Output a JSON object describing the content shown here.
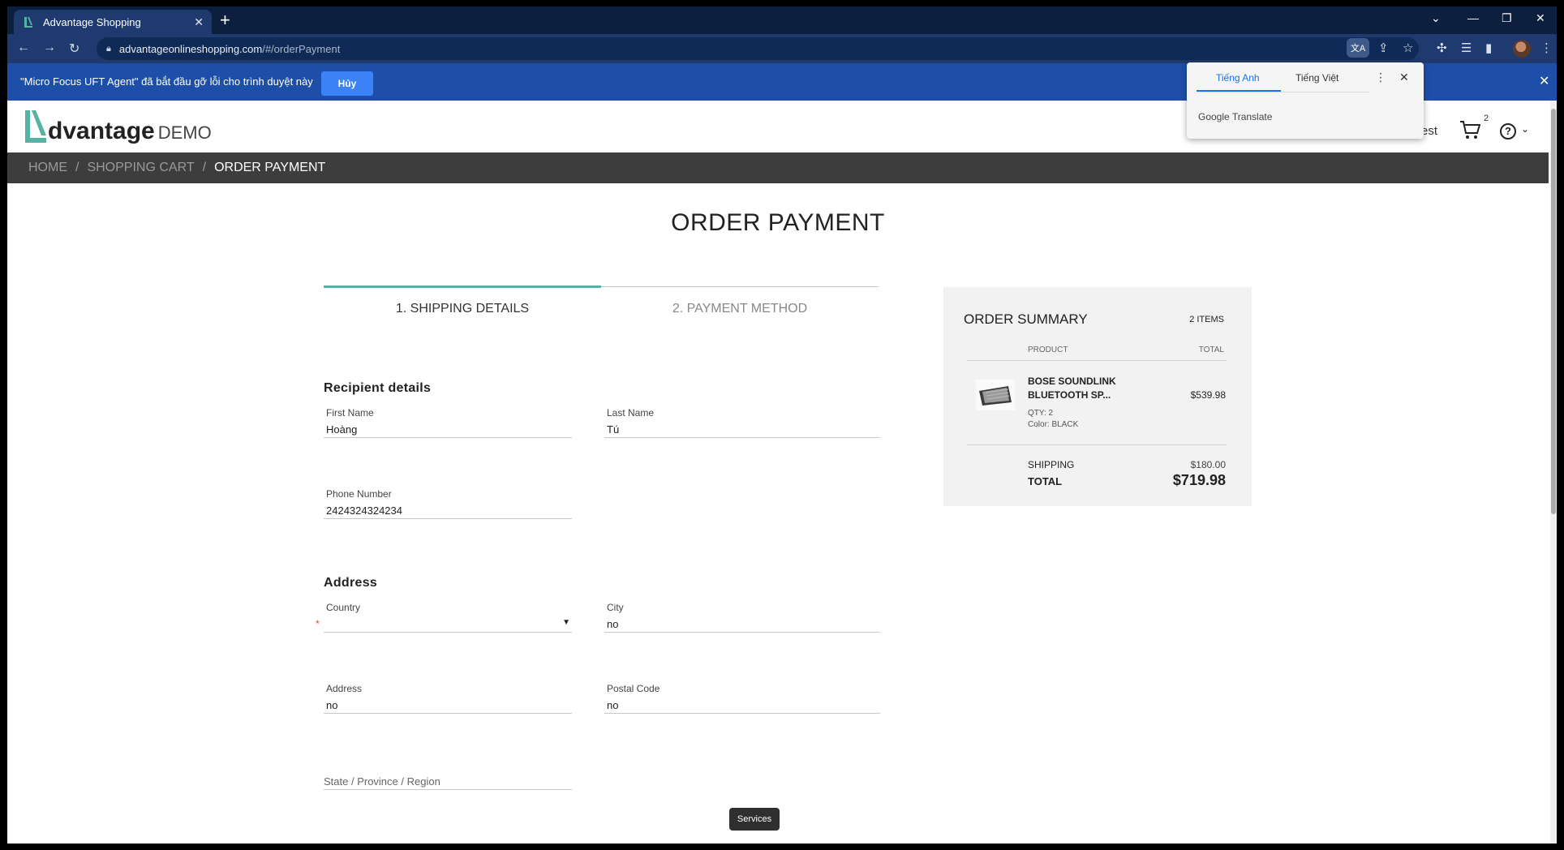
{
  "browser": {
    "tab_title": "Advantage Shopping",
    "url_host": "advantageonlineshopping.com",
    "url_path": "/#/orderPayment"
  },
  "infobar": {
    "message": "\"Micro Focus UFT Agent\" đã bắt đầu gỡ lỗi cho trình duyệt này",
    "cancel_label": "Hủy"
  },
  "translate_popup": {
    "tab_source": "Tiếng Anh",
    "tab_target": "Tiếng Việt",
    "brand": "Google Translate"
  },
  "site": {
    "logo_word": "dvantage",
    "logo_demo": "DEMO",
    "user_fragment": "est",
    "cart_count": "2"
  },
  "breadcrumb": {
    "home": "HOME",
    "cart": "SHOPPING CART",
    "current": "ORDER PAYMENT",
    "separator": "/"
  },
  "page": {
    "title": "ORDER PAYMENT",
    "step1": "1. SHIPPING DETAILS",
    "step2": "2. PAYMENT METHOD"
  },
  "recipient": {
    "section_title": "Recipient details",
    "first_name_label": "First Name",
    "first_name": "Hoàng",
    "last_name_label": "Last Name",
    "last_name": "Tú",
    "phone_label": "Phone Number",
    "phone": "2424324324234"
  },
  "address": {
    "section_title": "Address",
    "country_label": "Country",
    "country_value": "",
    "required_mark": "*",
    "city_label": "City",
    "city": "no",
    "address_label": "Address",
    "address": "no",
    "postal_label": "Postal Code",
    "postal": "no",
    "state_placeholder": "State / Province / Region"
  },
  "summary": {
    "title": "ORDER SUMMARY",
    "items_count": "2 ITEMS",
    "col_product": "PRODUCT",
    "col_total": "TOTAL",
    "product_name": "BOSE SOUNDLINK BLUETOOTH SP...",
    "product_qty": "QTY: 2",
    "product_color": "Color: BLACK",
    "product_price": "$539.98",
    "shipping_label": "SHIPPING",
    "shipping_value": "$180.00",
    "total_label": "TOTAL",
    "total_value": "$719.98"
  },
  "footer": {
    "services_label": "Services"
  },
  "colors": {
    "accent": "#54b3a2",
    "infobar": "#1e4fa8",
    "breadcrumb_bg": "#3d3d3d"
  }
}
